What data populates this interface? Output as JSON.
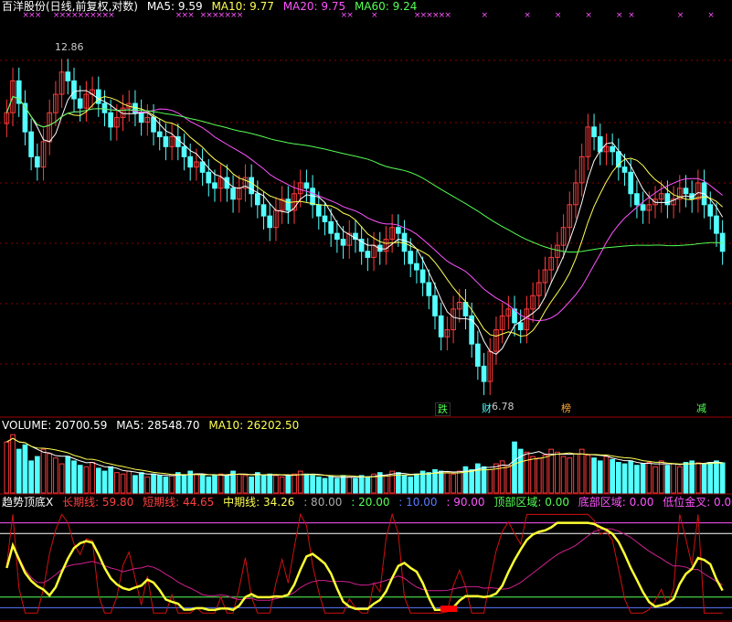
{
  "colors": {
    "bg": "#000000",
    "up": "#ff3b3b",
    "down": "#54ffff",
    "ma5": "#ffffff",
    "ma10": "#ffff54",
    "ma20": "#ff54ff",
    "ma60": "#54ff54",
    "grid": "#8b0000"
  },
  "main_legend": {
    "title": "百洋股份(日线,前复权,对数)",
    "ma5": "MA5: 9.59",
    "ma10": "MA10: 9.77",
    "ma20": "MA20: 9.75",
    "ma60": "MA60: 9.24"
  },
  "volume_legend": {
    "title": "VOLUME: 20700.59",
    "ma5": "MA5: 28548.70",
    "ma10": "MA10: 26202.50"
  },
  "indicator_legend": {
    "title": "趋势顶底X",
    "long": "长期线: 59.80",
    "short": "短期线: 44.65",
    "mid": "中期线: 34.26",
    "v80": ": 80.00",
    "v20": ": 20.00",
    "v10": ": 10.00",
    "v90": ": 90.00",
    "top": "顶部区域: 0.00",
    "bottom": "底部区域: 0.00",
    "cross": "低位金叉: 0.00"
  },
  "markers": {
    "high_label": "12.86",
    "low_label": "6.78",
    "tag1": "跌",
    "tag2": "财",
    "tag3": "榜",
    "tag4": "减"
  },
  "chart_data": [
    {
      "type": "candlestick",
      "title": "百洋股份(日线,前复权,对数)",
      "ylim": [
        6.5,
        13.6
      ],
      "high": 12.86,
      "low": 6.78,
      "closes": [
        11.4,
        12.1,
        11.6,
        11.0,
        10.5,
        10.3,
        10.8,
        11.4,
        11.8,
        12.3,
        12.1,
        11.7,
        11.5,
        11.8,
        11.9,
        11.6,
        11.4,
        11.1,
        11.3,
        11.5,
        11.6,
        11.4,
        11.2,
        11.3,
        11.0,
        10.9,
        10.7,
        10.9,
        10.7,
        10.5,
        10.3,
        10.4,
        10.2,
        10.0,
        9.9,
        10.1,
        9.9,
        9.7,
        9.9,
        10.1,
        9.8,
        9.6,
        9.4,
        9.2,
        9.5,
        9.7,
        9.5,
        9.8,
        10.0,
        9.9,
        9.6,
        9.4,
        9.3,
        9.1,
        9.0,
        8.9,
        9.1,
        9.0,
        8.8,
        8.7,
        8.9,
        8.8,
        9.0,
        9.2,
        9.1,
        8.8,
        8.6,
        8.5,
        8.3,
        8.1,
        7.8,
        7.5,
        7.6,
        7.9,
        8.0,
        7.8,
        7.4,
        7.1,
        6.9,
        7.3,
        7.6,
        7.8,
        7.9,
        7.7,
        7.6,
        7.9,
        8.1,
        8.3,
        8.5,
        8.7,
        8.9,
        9.2,
        9.6,
        10.0,
        10.5,
        11.1,
        10.9,
        10.6,
        10.7,
        10.6,
        10.3,
        10.2,
        9.8,
        9.6,
        9.5,
        9.6,
        9.7,
        9.8,
        9.6,
        9.7,
        9.9,
        9.8,
        9.7,
        10.0,
        9.6,
        9.4,
        9.1,
        8.8
      ],
      "ma_legend": [
        "MA5: 9.59",
        "MA10: 9.77",
        "MA20: 9.75",
        "MA60: 9.24"
      ]
    },
    {
      "type": "bar",
      "title": "VOLUME",
      "values": [
        35000,
        40000,
        30000,
        33000,
        22000,
        25000,
        30000,
        27000,
        24000,
        20000,
        25000,
        22000,
        19000,
        18000,
        21000,
        17000,
        15000,
        18000,
        14000,
        13000,
        15000,
        12000,
        14000,
        11000,
        13000,
        12000,
        11000,
        12000,
        14000,
        12000,
        15000,
        13000,
        12000,
        11000,
        12000,
        13000,
        12000,
        15000,
        13000,
        12000,
        11000,
        14000,
        12000,
        13000,
        12000,
        11000,
        12000,
        13000,
        15000,
        13000,
        12000,
        11000,
        10000,
        11000,
        10000,
        12000,
        11000,
        10000,
        12000,
        11000,
        13000,
        14000,
        12000,
        15000,
        14000,
        12000,
        11000,
        13000,
        15000,
        14000,
        16000,
        15000,
        14000,
        13000,
        15000,
        18000,
        16000,
        20000,
        18000,
        16000,
        20000,
        22000,
        19000,
        35000,
        30000,
        28000,
        25000,
        24000,
        26000,
        30000,
        28000,
        25000,
        24000,
        27000,
        30000,
        26000,
        24000,
        22000,
        25000,
        23000,
        21000,
        20000,
        22000,
        19000,
        20000,
        21000,
        18000,
        22000,
        19000,
        20000,
        18000,
        21000,
        22000,
        20700,
        20000,
        21000,
        22000,
        20700
      ],
      "ma5": 28548.7,
      "ma10": 26202.5
    },
    {
      "type": "line",
      "title": "趋势顶底X",
      "ylim": [
        0,
        100
      ],
      "levels": [
        80,
        20,
        10,
        90
      ],
      "series": [
        {
          "name": "长期线",
          "last": 59.8
        },
        {
          "name": "短期线",
          "last": 44.65
        },
        {
          "name": "中期线",
          "last": 34.26
        }
      ],
      "zones": {
        "顶部区域": 0,
        "底部区域": 0,
        "低位金叉": 0
      }
    }
  ]
}
